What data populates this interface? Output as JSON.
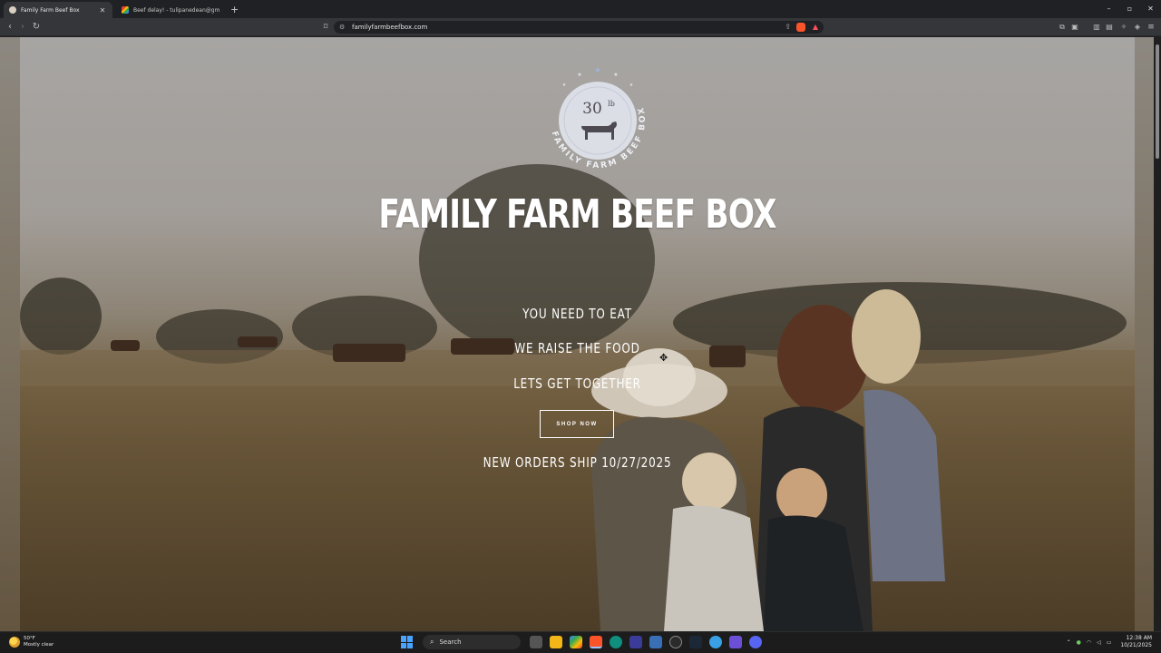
{
  "browser": {
    "tabs": [
      {
        "title": "Family Farm Beef Box",
        "active": true
      },
      {
        "title": "Beef delay! - tulipanedean@gmail.co",
        "active": false
      }
    ],
    "new_tab": "+",
    "url": "familyfarmbeefbox.com",
    "window_controls": {
      "minimize": "–",
      "maximize": "▫",
      "close": "✕"
    }
  },
  "hero": {
    "logo": {
      "weight": "30",
      "unit": "lb",
      "ring_text": "FAMILY FARM BEEF BOX"
    },
    "title": "FAMILY FARM BEEF BOX",
    "taglines": [
      "YOU NEED TO EAT",
      "WE RAISE THE FOOD",
      "LETS GET TOGETHER"
    ],
    "cta_label": "SHOP NOW",
    "ship_notice": "NEW ORDERS SHIP 10/27/2025"
  },
  "taskbar": {
    "weather": {
      "temp": "50°F",
      "condition": "Mostly clear"
    },
    "search_label": "Search",
    "time": "12:38 AM",
    "date": "10/21/2025"
  },
  "colors": {
    "browser_bg": "#202124",
    "toolbar_bg": "#35363a",
    "hero_text": "#ffffff",
    "logo_badge": "#dfe3ec",
    "logo_ink": "#4d4a52"
  }
}
